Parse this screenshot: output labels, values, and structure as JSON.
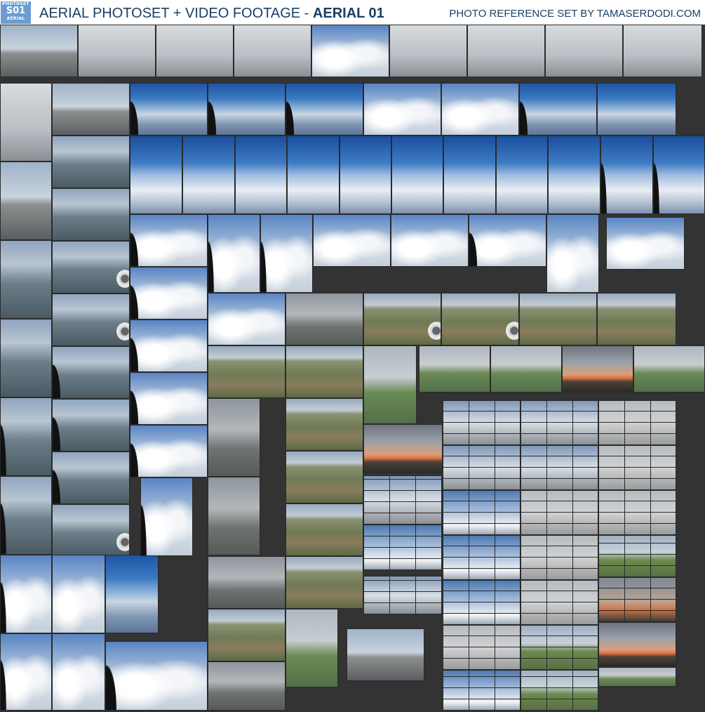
{
  "header": {
    "badge_top": "PHOTOSET",
    "badge_main": "S01",
    "badge_bottom": "AERIAL",
    "title_main": "AERIAL PHOTOSET + VIDEO FOOTAGE - ",
    "title_bold": "AERIAL 01",
    "credit": "PHOTO REFERENCE SET BY TAMASERDODI.COM"
  },
  "colors": {
    "background": "#333333",
    "header_text": "#1a3f66",
    "badge": "#6b9dd4"
  }
}
